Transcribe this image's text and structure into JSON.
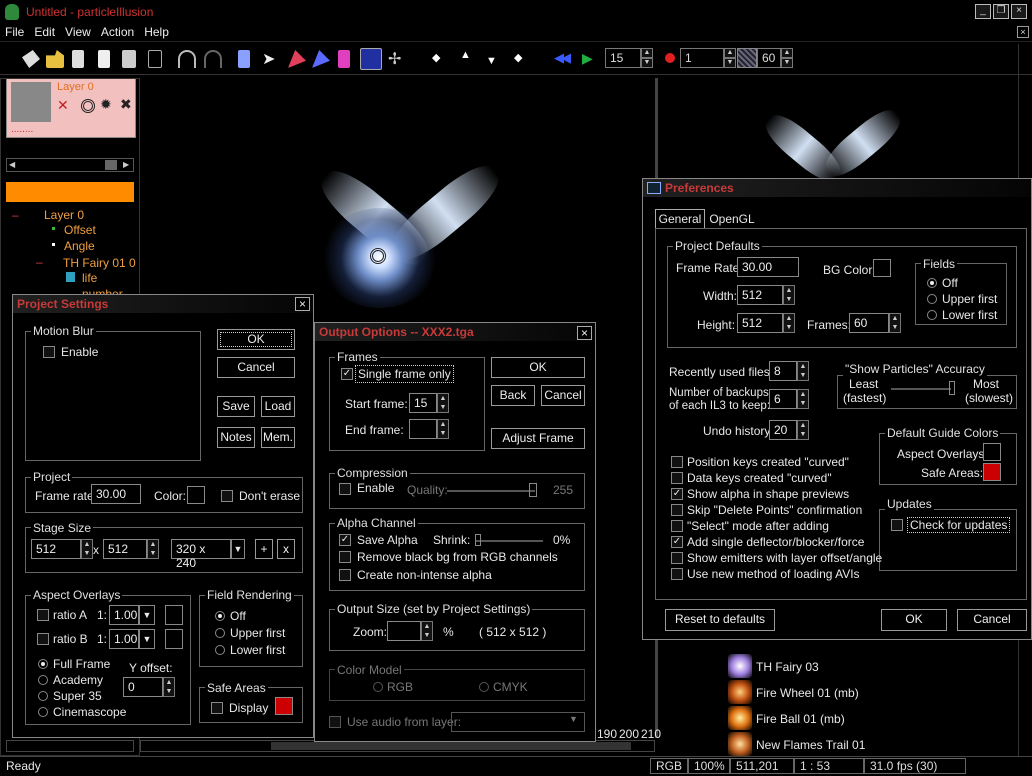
{
  "app": {
    "title": "Untitled - particleIllusion"
  },
  "menu": [
    "File",
    "Edit",
    "View",
    "Action",
    "Help"
  ],
  "toolbar": {
    "frame_value": "15",
    "record_value": "1",
    "fps_value": "60"
  },
  "layer_panel": {
    "layer_name": "Layer 0",
    "dotted": "........"
  },
  "tree": {
    "items": [
      "Layer 0",
      "Offset",
      "Angle",
      "TH Fairy 01 0",
      "life",
      "number"
    ]
  },
  "timeline": {
    "ticks": [
      "190",
      "200",
      "210"
    ]
  },
  "emitters": [
    "TH Fairy 03",
    "Fire Wheel 01 (mb)",
    "Fire Ball 01 (mb)",
    "New Flames Trail 01"
  ],
  "status": {
    "ready": "Ready",
    "mode": "RGB",
    "zoom": "100%",
    "coords": "511,201",
    "time": "1 : 53",
    "fps": "31.0 fps (30)"
  },
  "project": {
    "title": "Project Settings",
    "motion_blur": "Motion Blur",
    "enable": "Enable",
    "ok": "OK",
    "cancel": "Cancel",
    "save": "Save",
    "load": "Load",
    "notes": "Notes",
    "mem": "Mem.",
    "project_grp": "Project",
    "frame_rate_label": "Frame rate:",
    "frame_rate": "30.00",
    "color_label": "Color:",
    "dont_erase": "Don't erase",
    "stage_size": "Stage Size",
    "width": "512",
    "height": "512",
    "x": "x",
    "preset": "320 x 240",
    "plus": "+",
    "xbtn": "x",
    "aspect": "Aspect Overlays",
    "ratio_a": "ratio A",
    "ratio_b": "ratio B",
    "one": "1:",
    "ratio_val": "1.00",
    "full_frame": "Full Frame",
    "academy": "Academy",
    "super35": "Super 35",
    "cinemascope": "Cinemascope",
    "y_offset": "Y offset:",
    "y_val": "0",
    "field_rendering": "Field Rendering",
    "off": "Off",
    "upper": "Upper first",
    "lower": "Lower first",
    "safe_areas": "Safe Areas",
    "display": "Display"
  },
  "output": {
    "title": "Output Options -- XXX2.tga",
    "frames": "Frames",
    "single": "Single frame only",
    "start_label": "Start frame:",
    "start_val": "15",
    "end_label": "End frame:",
    "ok": "OK",
    "back": "Back",
    "cancel": "Cancel",
    "adjust": "Adjust Frame",
    "compression": "Compression",
    "enable": "Enable",
    "quality": "Quality:",
    "quality_val": "255",
    "alpha": "Alpha Channel",
    "save_alpha": "Save Alpha",
    "shrink": "Shrink:",
    "shrink_val": "0%",
    "remove_black": "Remove black bg from RGB channels",
    "non_intense": "Create non-intense alpha",
    "output_size": "Output Size  (set by Project Settings)",
    "zoom": "Zoom:",
    "pct": "%",
    "size": "( 512 x 512 )",
    "color_model": "Color Model",
    "rgb": "RGB",
    "cmyk": "CMYK",
    "use_audio": "Use audio from layer:"
  },
  "prefs": {
    "title": "Preferences",
    "tab_general": "General",
    "tab_opengl": "OpenGL",
    "project_defaults": "Project Defaults",
    "frame_rate_label": "Frame Rate:",
    "frame_rate": "30.00",
    "bg_color": "BG Color:",
    "width_label": "Width:",
    "width": "512",
    "height_label": "Height:",
    "height": "512",
    "frames_label": "Frames:",
    "frames": "60",
    "fields": "Fields",
    "off": "Off",
    "upper": "Upper first",
    "lower": "Lower first",
    "recent_label": "Recently used files:",
    "recent": "8",
    "backups_label1": "Number of backups",
    "backups_label2": "of each IL3 to keep:",
    "backups": "6",
    "undo_label": "Undo history:",
    "undo": "20",
    "show_particles": "\"Show Particles\" Accuracy",
    "least": "Least",
    "fastest": "(fastest)",
    "most": "Most",
    "slowest": "(slowest)",
    "guide_colors": "Default Guide Colors",
    "aspect_overlays": "Aspect Overlays:",
    "safe_areas": "Safe Areas:",
    "updates": "Updates",
    "check_updates": "Check for updates",
    "checks": [
      {
        "label": "Position keys created \"curved\"",
        "on": false
      },
      {
        "label": "Data keys created \"curved\"",
        "on": false
      },
      {
        "label": "Show alpha in shape previews",
        "on": true
      },
      {
        "label": "Skip \"Delete Points\" confirmation",
        "on": false
      },
      {
        "label": "\"Select\" mode after adding",
        "on": false
      },
      {
        "label": "Add single deflector/blocker/force",
        "on": true
      },
      {
        "label": "Show emitters with layer offset/angle",
        "on": false
      },
      {
        "label": "Use new method of loading AVIs",
        "on": false
      }
    ],
    "reset": "Reset to defaults",
    "ok": "OK",
    "cancel": "Cancel"
  },
  "colors": {
    "accent_red": "#d03030",
    "orange": "#ff8c00",
    "safe_red": "#cc0000"
  }
}
